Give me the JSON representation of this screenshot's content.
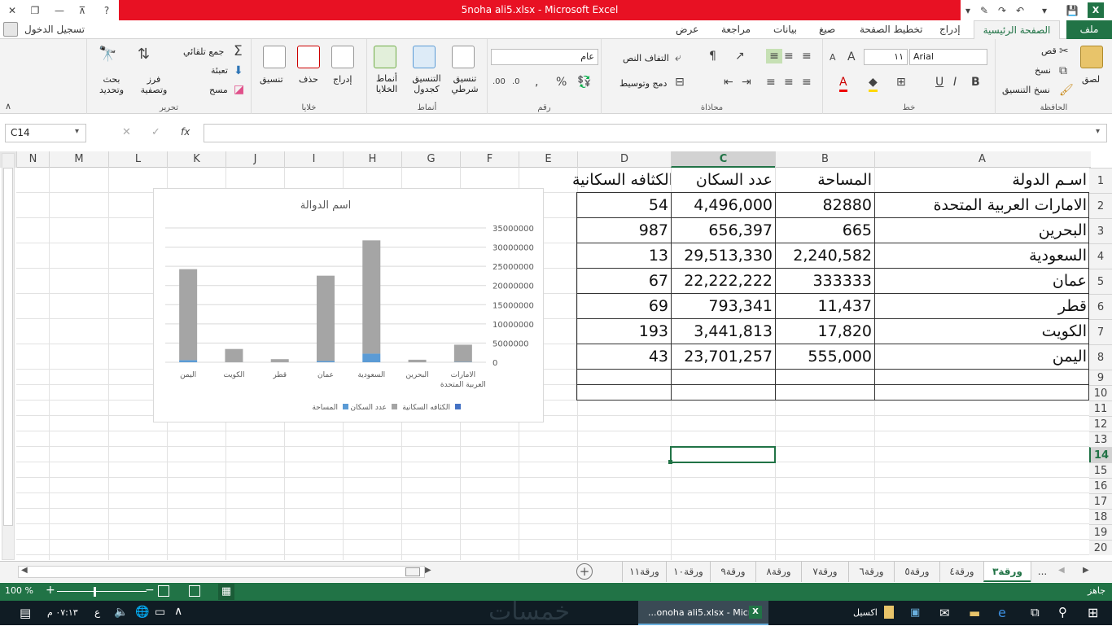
{
  "window": {
    "title": "5noha ali5.xlsx - Microsoft Excel",
    "login": "تسجيل الدخول"
  },
  "tabs": [
    "ملف",
    "الصفحة الرئيسية",
    "إدراج",
    "تخطيط الصفحة",
    "صيغ",
    "بيانات",
    "مراجعة",
    "عرض"
  ],
  "ribbon": {
    "clipboard": {
      "label": "الحافظة",
      "paste": "لصق",
      "cut": "قص",
      "copy": "نسخ",
      "format_painter": "نسخ التنسيق"
    },
    "font": {
      "label": "خط",
      "name": "Arial",
      "size": "١١"
    },
    "alignment": {
      "label": "محاذاة",
      "wrap": "التفاف النص",
      "merge": "دمج وتوسيط"
    },
    "number": {
      "label": "رقم",
      "format": "عام"
    },
    "styles": {
      "label": "أنماط",
      "conditional": "تنسيق شرطي",
      "as_table": "التنسيق كجدول",
      "cell_styles": "أنماط الخلايا"
    },
    "cells": {
      "label": "خلايا",
      "insert": "إدراج",
      "delete": "حذف",
      "format": "تنسيق"
    },
    "editing": {
      "label": "تحرير",
      "autosum": "جمع تلقائي",
      "fill": "تعبئة",
      "clear": "مسح",
      "sort": "فرز وتصفية",
      "find": "بحث وتحديد"
    }
  },
  "formula_bar": {
    "name_box": "C14",
    "fx": "fx",
    "value": ""
  },
  "columns": [
    "N",
    "M",
    "L",
    "K",
    "J",
    "I",
    "H",
    "G",
    "F",
    "E",
    "D",
    "C",
    "B",
    "A"
  ],
  "rows": [
    "1",
    "2",
    "3",
    "4",
    "5",
    "6",
    "7",
    "8",
    "9",
    "10",
    "11",
    "12",
    "13",
    "14",
    "15",
    "16",
    "17",
    "18",
    "19",
    "20"
  ],
  "table": {
    "headers": [
      "اسـم الدولة",
      "المساحة",
      "عدد السكان",
      "الكثافه السكانية"
    ],
    "rows": [
      [
        "الامارات العربية المتحدة",
        "82880",
        "4,496,000",
        "54"
      ],
      [
        "البحرين",
        "665",
        "656,397",
        "987"
      ],
      [
        "السعودية",
        "2,240,582",
        "29,513,330",
        "13"
      ],
      [
        "عمان",
        "333333",
        "22,222,222",
        "67"
      ],
      [
        "قطر",
        "11,437",
        "793,341",
        "69"
      ],
      [
        "الكويت",
        "17,820",
        "3,441,813",
        "193"
      ],
      [
        "اليمن",
        "555,000",
        "23,701,257",
        "43"
      ]
    ]
  },
  "chart_data": {
    "type": "bar",
    "title": "اسم الدوالة",
    "categories": [
      "الامارات العربية المتحدة",
      "البحرين",
      "السعودية",
      "عمان",
      "قطر",
      "الكويت",
      "اليمن"
    ],
    "series": [
      {
        "name": "المساحة",
        "values": [
          82880,
          665,
          2240582,
          333333,
          11437,
          17820,
          555000
        ],
        "color": "#5b9bd5"
      },
      {
        "name": "عدد السكان",
        "values": [
          4496000,
          656397,
          29513330,
          22222222,
          793341,
          3441813,
          23701257
        ],
        "color": "#a5a5a5"
      },
      {
        "name": "الكثافه السكانية",
        "values": [
          54,
          987,
          13,
          67,
          69,
          193,
          43
        ],
        "color": "#4472c4"
      }
    ],
    "stacked": true,
    "ylim": [
      0,
      35000000
    ],
    "yticks": [
      "0",
      "5000000",
      "10000000",
      "15000000",
      "20000000",
      "25000000",
      "30000000",
      "35000000"
    ],
    "grid": true,
    "legend": "bottom"
  },
  "sheets": {
    "tabs": [
      "ورقة٣",
      "ورقة٤",
      "ورقة٥",
      "ورقة٦",
      "ورقة٧",
      "ورقة٨",
      "ورقة٩",
      "ورقة١٠",
      "ورقة١١"
    ],
    "more": "...",
    "active": "ورقة٣"
  },
  "status": {
    "ready": "جاهز",
    "zoom": "100 %"
  },
  "taskbar": {
    "time": "٠٧:١٣ م",
    "lang": "ع",
    "app_window": "...onoha ali5.xlsx - Micr",
    "excel_label": "اكسيل",
    "watermark": "خمسات"
  },
  "colors": {
    "excel_green": "#217346",
    "title_red": "#e81123"
  }
}
